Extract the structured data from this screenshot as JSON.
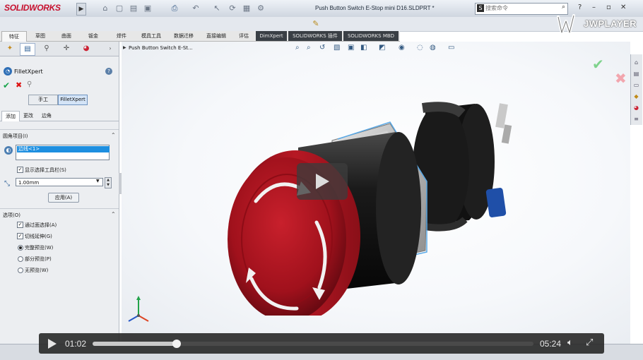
{
  "app": {
    "logo_text": "SOLIDWORKS",
    "document_title": "Push Button Switch E-Stop mini D16.SLDPRT *",
    "search_placeholder": "搜索命令",
    "menu_arrow": "▶"
  },
  "player": {
    "brand": "JWPLAYER",
    "current_time": "01:02",
    "duration": "05:24",
    "progress": 0.19
  },
  "command_tabs": [
    "特征",
    "草图",
    "曲面",
    "钣金",
    "焊件",
    "模具工具",
    "数据迁移",
    "直接编辑",
    "评估",
    "DimXpert",
    "SOLIDWORKS 插件",
    "SOLIDWORKS MBD"
  ],
  "property_manager": {
    "feature_name": "FilletXpert",
    "mode_buttons": [
      "手工",
      "FilletXpert"
    ],
    "selected_mode": 1,
    "sub_tabs": [
      "添加",
      "更改",
      "边角"
    ],
    "section_items_header": "圆角项目(I)",
    "selected_item": "边线<1>",
    "show_toolbar_label": "显示选择工具栏(S)",
    "show_toolbar_checked": true,
    "radius_value": "1.00mm",
    "apply_button": "应用(A)",
    "options_header": "选项(O)",
    "options": [
      {
        "label": "通过面选择(A)",
        "type": "check",
        "checked": true
      },
      {
        "label": "切线延伸(G)",
        "type": "check",
        "checked": true
      },
      {
        "label": "完整预览(W)",
        "type": "radio",
        "checked": true
      },
      {
        "label": "部分预览(P)",
        "type": "radio",
        "checked": false
      },
      {
        "label": "无预览(W)",
        "type": "radio",
        "checked": false
      }
    ]
  },
  "viewport": {
    "tree_label": "Push Button Switch E-St..."
  },
  "colors": {
    "cap_red": "#b3121f",
    "body_black": "#1c1c1c",
    "selection_blue": "#1e8fe0",
    "confirm_green": "#7fd38d"
  }
}
